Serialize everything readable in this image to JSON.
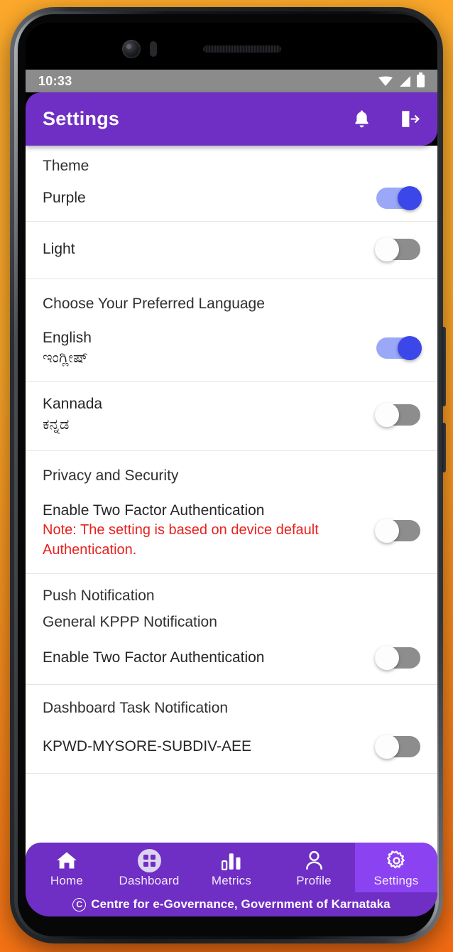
{
  "device": {
    "status_bar": {
      "time": "10:33",
      "icons": [
        "wifi-icon",
        "signal-icon",
        "battery-icon"
      ]
    }
  },
  "appbar": {
    "title": "Settings",
    "actions": [
      {
        "name": "notifications-bell-icon",
        "icon": "bell-icon"
      },
      {
        "name": "logout-button",
        "icon": "logout-icon"
      }
    ]
  },
  "sections": [
    {
      "id": "theme",
      "title": "Theme",
      "rows": [
        {
          "label": "Purple",
          "sub": "",
          "note": "",
          "toggle": "on"
        },
        {
          "label": "Light",
          "sub": "",
          "note": "",
          "toggle": "off"
        }
      ]
    },
    {
      "id": "language",
      "title": "Choose Your Preferred Language",
      "rows": [
        {
          "label": "English",
          "sub": "ಇಂಗ್ಲೀಷ್",
          "note": "",
          "toggle": "on"
        },
        {
          "label": "Kannada",
          "sub": "ಕನ್ನಡ",
          "note": "",
          "toggle": "off"
        }
      ]
    },
    {
      "id": "privacy",
      "title": "Privacy and Security",
      "rows": [
        {
          "label": "Enable Two Factor Authentication",
          "sub": "",
          "note": "Note: The setting is based on device default Authentication.",
          "toggle": "off"
        }
      ]
    },
    {
      "id": "push",
      "title": "Push Notification",
      "subtitle": "General KPPP Notification",
      "rows": [
        {
          "label": "Enable Two Factor Authentication",
          "sub": "",
          "note": "",
          "toggle": "off"
        }
      ]
    },
    {
      "id": "dashboard-task",
      "title": "Dashboard Task Notification",
      "rows": [
        {
          "label": "KPWD-MYSORE-SUBDIV-AEE",
          "sub": "",
          "note": "",
          "toggle": "off"
        }
      ]
    }
  ],
  "bottom_nav": {
    "items": [
      {
        "label": "Home",
        "icon": "home-icon",
        "active": false
      },
      {
        "label": "Dashboard",
        "icon": "grid-dashboard-icon",
        "active": false
      },
      {
        "label": "Metrics",
        "icon": "bar-chart-icon",
        "active": false
      },
      {
        "label": "Profile",
        "icon": "person-icon",
        "active": false
      },
      {
        "label": "Settings",
        "icon": "gear-icon",
        "active": true
      }
    ]
  },
  "footer": {
    "copyright_symbol": "C",
    "text": "Centre for e-Governance, Government of Karnataka"
  },
  "colors": {
    "brand_purple": "#6f2ec4",
    "active_purple": "#8b42f0",
    "toggle_on_track": "#9aa8f7",
    "toggle_on_thumb": "#3b47e8",
    "toggle_off_track": "#8d8d8d",
    "note_red": "#e8221f",
    "status_bar_gray": "#8b8b8b",
    "background_orange": "#FBA828"
  }
}
